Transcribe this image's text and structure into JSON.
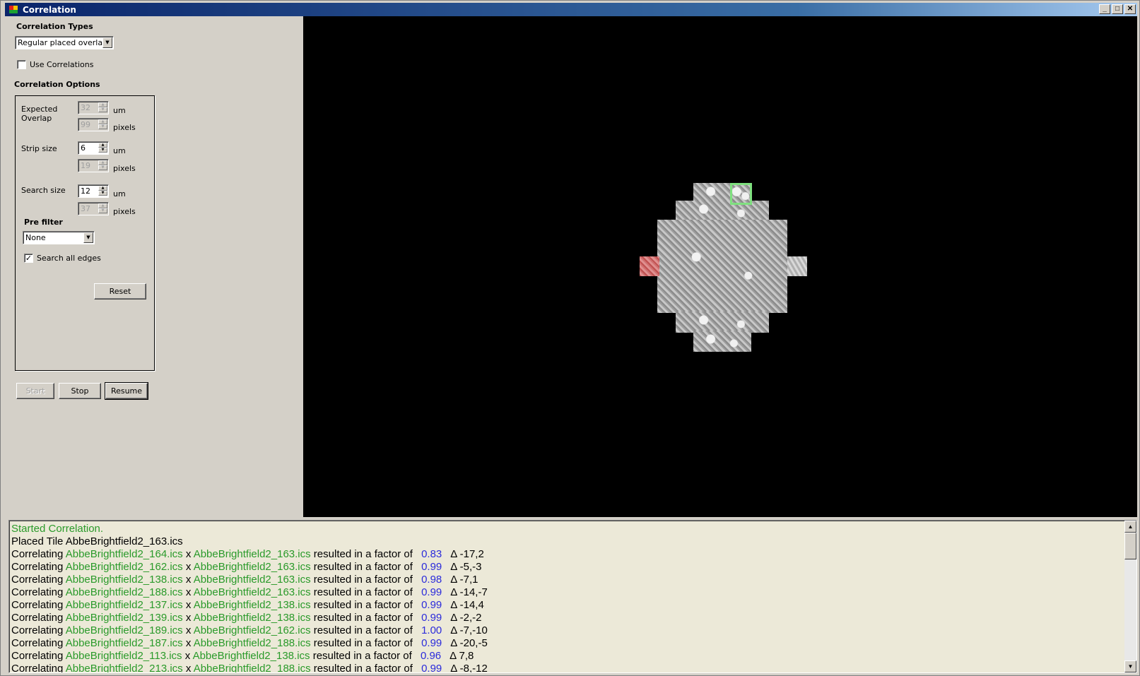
{
  "window": {
    "title": "Correlation"
  },
  "sidebar": {
    "correlation_types_label": "Correlation Types",
    "correlation_type_selected": "Regular placed overlap",
    "use_correlations_label": "Use Correlations",
    "use_correlations_checked": false,
    "options_label": "Correlation Options",
    "expected_overlap_label": "Expected Overlap",
    "expected_overlap_um": "32",
    "expected_overlap_pixels": "99",
    "strip_size_label": "Strip size",
    "strip_size_um": "6",
    "strip_size_pixels": "19",
    "search_size_label": "Search size",
    "search_size_um": "12",
    "search_size_pixels": "37",
    "unit_um": "um",
    "unit_pixels": "pixels",
    "prefilter_label": "Pre filter",
    "prefilter_selected": "None",
    "search_all_edges_label": "Search all edges",
    "search_all_edges_checked": true,
    "reset_label": "Reset",
    "start_label": "Start",
    "stop_label": "Stop",
    "resume_label": "Resume"
  },
  "log": {
    "lines": [
      {
        "kind": "status",
        "text": "Started Correlation."
      },
      {
        "kind": "placed",
        "prefix": "Placed  Tile ",
        "tile": "AbbeBrightfield2_163.ics"
      },
      {
        "kind": "corr",
        "a": "AbbeBrightfield2_164.ics",
        "b": "AbbeBrightfield2_163.ics",
        "factor": "0.83",
        "delta": "Δ -17,2"
      },
      {
        "kind": "corr",
        "a": "AbbeBrightfield2_162.ics",
        "b": "AbbeBrightfield2_163.ics",
        "factor": "0.99",
        "delta": "Δ -5,-3"
      },
      {
        "kind": "corr",
        "a": "AbbeBrightfield2_138.ics",
        "b": "AbbeBrightfield2_163.ics",
        "factor": "0.98",
        "delta": "Δ -7,1"
      },
      {
        "kind": "corr",
        "a": "AbbeBrightfield2_188.ics",
        "b": "AbbeBrightfield2_163.ics",
        "factor": "0.99",
        "delta": "Δ -14,-7"
      },
      {
        "kind": "corr",
        "a": "AbbeBrightfield2_137.ics",
        "b": "AbbeBrightfield2_138.ics",
        "factor": "0.99",
        "delta": "Δ -14,4"
      },
      {
        "kind": "corr",
        "a": "AbbeBrightfield2_139.ics",
        "b": "AbbeBrightfield2_138.ics",
        "factor": "0.99",
        "delta": "Δ -2,-2"
      },
      {
        "kind": "corr",
        "a": "AbbeBrightfield2_189.ics",
        "b": "AbbeBrightfield2_162.ics",
        "factor": "1.00",
        "delta": "Δ -7,-10"
      },
      {
        "kind": "corr",
        "a": "AbbeBrightfield2_187.ics",
        "b": "AbbeBrightfield2_188.ics",
        "factor": "0.99",
        "delta": "Δ -20,-5"
      },
      {
        "kind": "corr",
        "a": "AbbeBrightfield2_113.ics",
        "b": "AbbeBrightfield2_138.ics",
        "factor": "0.96",
        "delta": "Δ 7,8"
      },
      {
        "kind": "corr",
        "a": "AbbeBrightfield2_213.ics",
        "b": "AbbeBrightfield2_188.ics",
        "factor": "0.99",
        "delta": "Δ -8,-12"
      }
    ],
    "word_correlating": "Correlating ",
    "word_x": " x ",
    "word_result": " resulted in a factor of "
  },
  "colors": {
    "filename": "#2a9a2a",
    "factor": "#2b2bdb",
    "status": "#2a9a2a",
    "selected_tile": "#7fe07f",
    "failed_tile": "#e09090"
  }
}
